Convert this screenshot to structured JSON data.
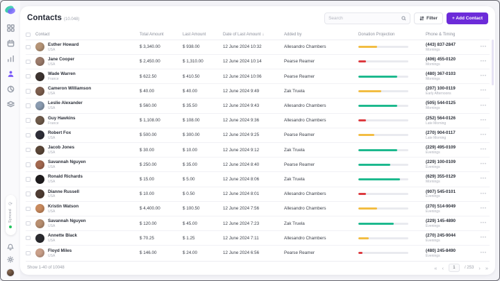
{
  "colors": {
    "accent": "#6c2bd9",
    "green": "#1db98e",
    "yellow": "#f2bd42",
    "red": "#dd3a3f",
    "track": "#e9eaef",
    "synced_dot": "#22c55e"
  },
  "sidebar": {
    "nav_icons": [
      "dashboard",
      "calendar",
      "analytics",
      "contacts",
      "reports",
      "campaigns"
    ],
    "active_icon": "contacts",
    "synced_label": "Synced",
    "sync_glyph": "⟳"
  },
  "header": {
    "title": "Contacts",
    "count": "(10.048)",
    "search_placeholder": "Search",
    "filter_label": "Filter",
    "add_contact_label": "+ Add Contact"
  },
  "table": {
    "columns": [
      "Contact",
      "Total Amount",
      "Last Amount",
      "Date of Last Amount",
      "Added by",
      "Donation Projection",
      "Phone & Timing"
    ],
    "sorted_column": "Date of Last Amount",
    "sort_indicator": "↓",
    "rows": [
      {
        "name": "Esther Howard",
        "country": "USA",
        "total": "$ 3,340.00",
        "last": "$ 938.00",
        "date": "12 June 2024 10:32",
        "added_by": "Allesandro Chambers",
        "projection_pct": 38,
        "projection_color": "yellow",
        "phone": "(443) 837-2847",
        "timing": "Mornings",
        "avatar_color": "#b59477"
      },
      {
        "name": "Jane Cooper",
        "country": "USA",
        "total": "$ 2,450.00",
        "last": "$ 1,310.00",
        "date": "12 June 2024 10:14",
        "added_by": "Pearse Reamer",
        "projection_pct": 15,
        "projection_color": "red",
        "phone": "(406) 455-0120",
        "timing": "Mornings",
        "avatar_color": "#9b7b6b"
      },
      {
        "name": "Wade Warren",
        "country": "France",
        "total": "$ 622.50",
        "last": "$ 410.50",
        "date": "12 June 2024 10:06",
        "added_by": "Pearse Reamer",
        "projection_pct": 78,
        "projection_color": "green",
        "phone": "(480) 367-0103",
        "timing": "Mornings",
        "avatar_color": "#3d3430"
      },
      {
        "name": "Cameron Williamson",
        "country": "USA",
        "total": "$ 40.00",
        "last": "$ 40.00",
        "date": "12 June 2024 9:49",
        "added_by": "Zak Truela",
        "projection_pct": 46,
        "projection_color": "yellow",
        "phone": "(207) 100-0119",
        "timing": "Early Afternoons",
        "avatar_color": "#7d5e4e"
      },
      {
        "name": "Leslie Alexander",
        "country": "USA",
        "total": "$ 560.00",
        "last": "$ 35.50",
        "date": "12 June 2024 9:43",
        "added_by": "Allesandro Chambers",
        "projection_pct": 78,
        "projection_color": "green",
        "phone": "(505) 544-0125",
        "timing": "Mornings",
        "avatar_color": "#8a9bb0"
      },
      {
        "name": "Guy Hawkins",
        "country": "France",
        "total": "$ 1,108.00",
        "last": "$ 108.00",
        "date": "12 June 2024 9:36",
        "added_by": "Allesandro Chambers",
        "projection_pct": 15,
        "projection_color": "red",
        "phone": "(252) 564-0126",
        "timing": "Late Morning",
        "avatar_color": "#6e5a4a"
      },
      {
        "name": "Robert Fox",
        "country": "USA",
        "total": "$ 500.00",
        "last": "$ 300.00",
        "date": "12 June 2024 9:25",
        "added_by": "Pearse Reamer",
        "projection_pct": 32,
        "projection_color": "yellow",
        "phone": "(270) 904-0117",
        "timing": "Late Morning",
        "avatar_color": "#2e2e38"
      },
      {
        "name": "Jacob Jones",
        "country": "USA",
        "total": "$ 30.00",
        "last": "$ 10.00",
        "date": "12 June 2024 9:12",
        "added_by": "Zak Truela",
        "projection_pct": 78,
        "projection_color": "green",
        "phone": "(229) 495-0109",
        "timing": "Evenings",
        "avatar_color": "#5a4638"
      },
      {
        "name": "Savannah Nguyen",
        "country": "USA",
        "total": "$ 250.00",
        "last": "$ 35.00",
        "date": "12 June 2024 8:40",
        "added_by": "Pearse Reamer",
        "projection_pct": 64,
        "projection_color": "green",
        "phone": "(229) 100-0109",
        "timing": "Evenings",
        "avatar_color": "#a3684f"
      },
      {
        "name": "Ronald Richards",
        "country": "USA",
        "total": "$ 15.00",
        "last": "$ 5.00",
        "date": "12 June 2024 8:06",
        "added_by": "Zak Truela",
        "projection_pct": 84,
        "projection_color": "green",
        "phone": "(629) 355-0129",
        "timing": "Mornings",
        "avatar_color": "#1f1c1e"
      },
      {
        "name": "Dianne Russell",
        "country": "USA",
        "total": "$ 10.00",
        "last": "$ 0.50",
        "date": "12 June 2024 8:01",
        "added_by": "Allesandro Chambers",
        "projection_pct": 15,
        "projection_color": "red",
        "phone": "(907) 545-0101",
        "timing": "Evenings",
        "avatar_color": "#4f3d33"
      },
      {
        "name": "Kristin Watson",
        "country": "USA",
        "total": "$ 4,400.00",
        "last": "$ 100.50",
        "date": "12 June 2024 7:56",
        "added_by": "Allesandro Chambers",
        "projection_pct": 38,
        "projection_color": "yellow",
        "phone": "(270) 514-9049",
        "timing": "Evenings",
        "avatar_color": "#c98a5e"
      },
      {
        "name": "Savannah Nguyen",
        "country": "USA",
        "total": "$ 120.00",
        "last": "$ 45.00",
        "date": "12 June 2024 7:23",
        "added_by": "Zak Truela",
        "projection_pct": 71,
        "projection_color": "green",
        "phone": "(229) 145-4890",
        "timing": "Evenings",
        "avatar_color": "#b98f70"
      },
      {
        "name": "Annette Black",
        "country": "USA",
        "total": "$ 70.25",
        "last": "$ 1.25",
        "date": "12 June 2024 7:11",
        "added_by": "Allesandro Chambers",
        "projection_pct": 21,
        "projection_color": "yellow",
        "phone": "(270) 245-9044",
        "timing": "Evenings",
        "avatar_color": "#2b2b30"
      },
      {
        "name": "Floyd Miles",
        "country": "USA",
        "total": "$ 146.00",
        "last": "$ 24.00",
        "date": "12 June 2024 6:56",
        "added_by": "Pearse Reamer",
        "projection_pct": 9,
        "projection_color": "red",
        "phone": "(480) 245-8490",
        "timing": "Evenings",
        "avatar_color": "#caa08a"
      }
    ]
  },
  "footer": {
    "summary": "Show 1-40 of 10048",
    "current_page": "1",
    "total_pages": "/ 253"
  },
  "icons": {
    "more_glyph": "•••",
    "first_page": "«",
    "prev_page": "‹",
    "next_page": "›",
    "last_page": "»"
  }
}
